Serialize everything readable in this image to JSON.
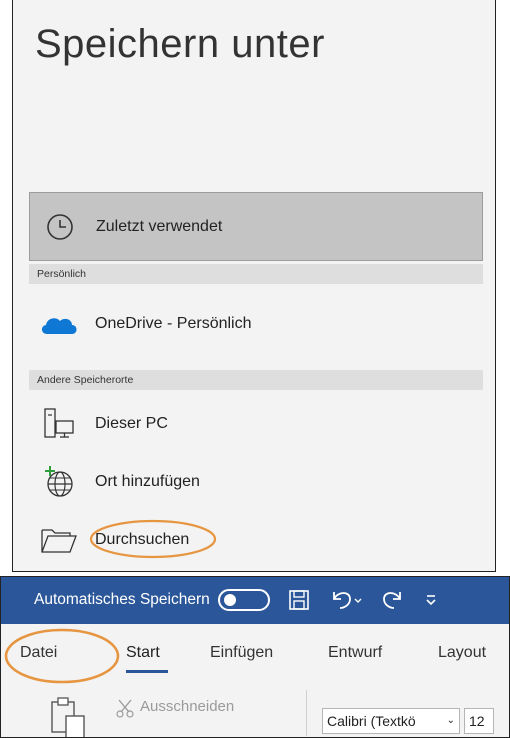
{
  "saveas": {
    "title": "Speichern unter",
    "recent_label": "Zuletzt verwendet",
    "section_personal": "Persönlich",
    "onedrive_label": "OneDrive - Persönlich",
    "section_other": "Andere Speicherorte",
    "thispc_label": "Dieser PC",
    "addplace_label": "Ort hinzufügen",
    "browse_label": "Durchsuchen"
  },
  "ribbon": {
    "autosave_label": "Automatisches Speichern",
    "tabs": [
      "Datei",
      "Start",
      "Einfügen",
      "Entwurf",
      "Layout"
    ],
    "cut_label": "Ausschneiden",
    "font_name": "Calibri (Textkö",
    "font_size": "12"
  },
  "colors": {
    "titlebar": "#2b579a",
    "highlight_circle": "#e69540",
    "onedrive": "#0f78d4"
  },
  "icons": [
    "clock-icon",
    "onedrive-cloud-icon",
    "computer-icon",
    "globe-add-icon",
    "folder-open-icon",
    "save-icon",
    "undo-icon",
    "redo-icon",
    "scissors-icon",
    "paste-icon"
  ]
}
